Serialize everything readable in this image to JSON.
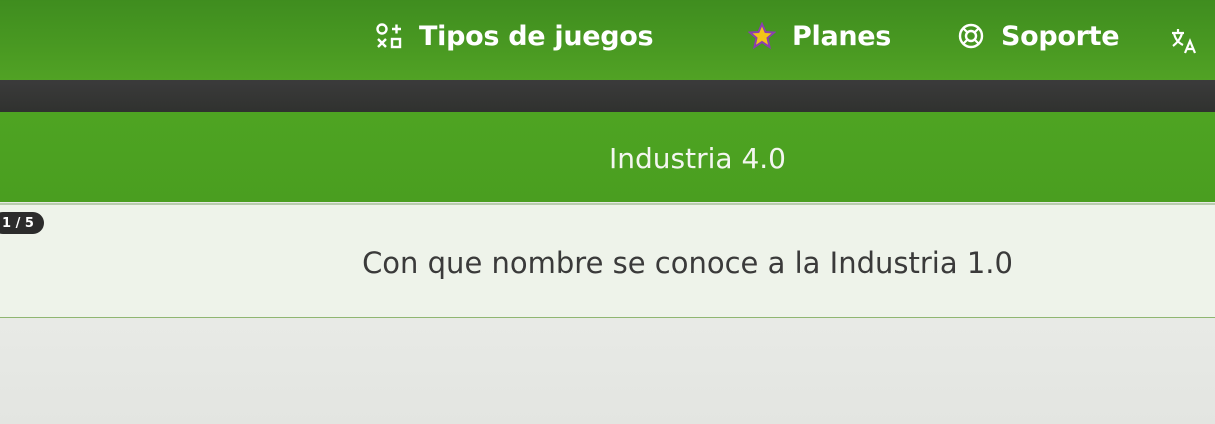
{
  "nav": {
    "tipos_label": "Tipos de juegos",
    "planes_label": "Planes",
    "soporte_label": "Soporte"
  },
  "quiz": {
    "title": "Industria 4.0",
    "counter": "1 / 5",
    "question": "Con que nombre se conoce a la Industria 1.0"
  },
  "colors": {
    "nav_green": "#4a9a22",
    "dark_band": "#2f312e",
    "title_green": "#4ea422",
    "star_yellow": "#f2c417",
    "star_outline": "#8b3fb0"
  }
}
